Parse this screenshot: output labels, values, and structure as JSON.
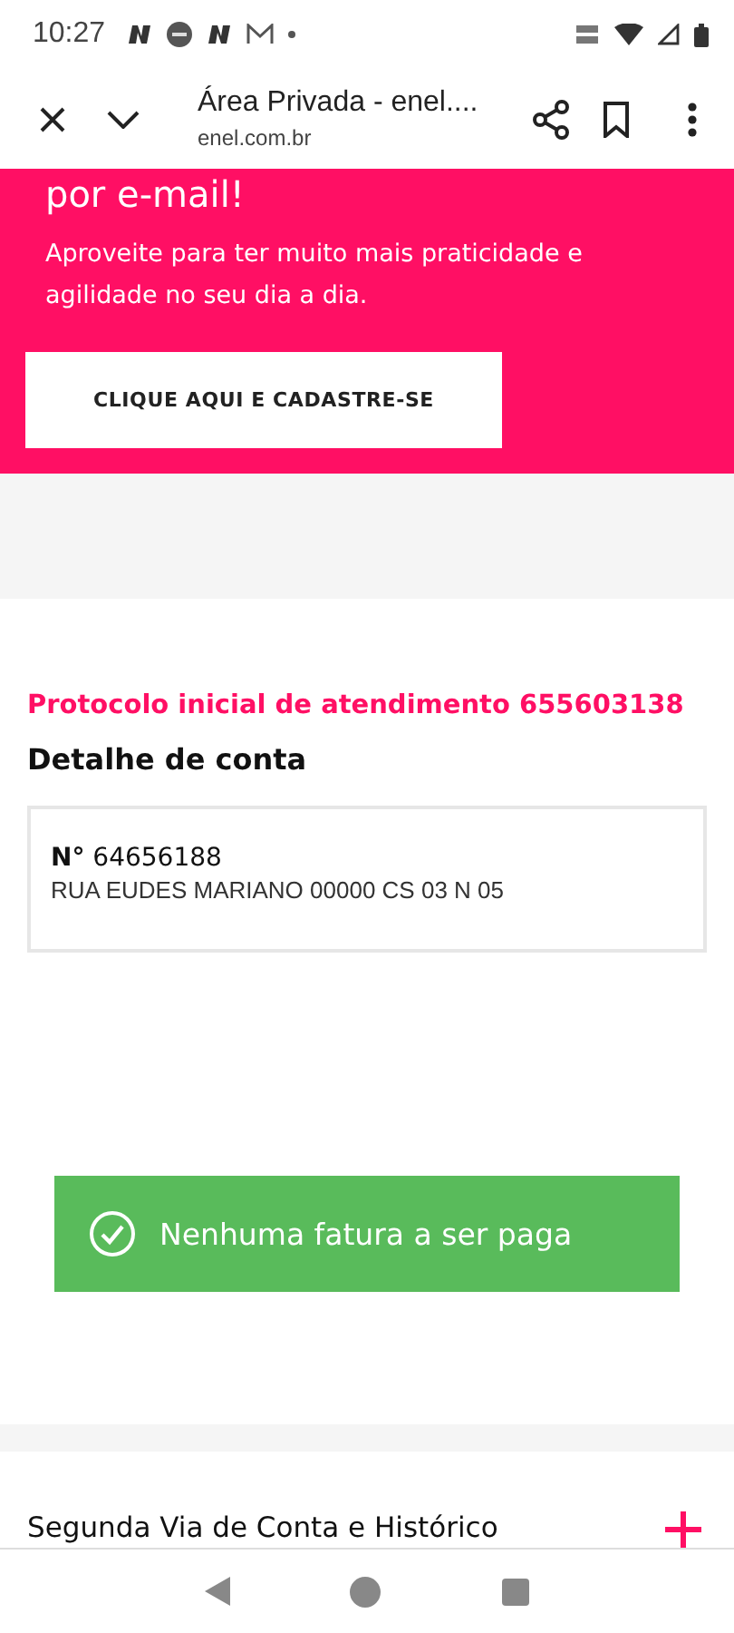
{
  "status_bar": {
    "time": "10:27"
  },
  "browser_bar": {
    "title": "Área Privada - enel....",
    "url": "enel.com.br"
  },
  "banner": {
    "heading": "por e-mail!",
    "text": "Aproveite para ter muito mais praticidade e agilidade no seu dia a dia.",
    "button": "CLIQUE AQUI E CADASTRE-SE"
  },
  "protocol": "Protocolo inicial de atendimento 655603138",
  "account": {
    "heading": "Detalhe de conta",
    "number_label": "N°",
    "number": "64656188",
    "address": "RUA EUDES MARIANO 00000 CS 03 N 05"
  },
  "notice": {
    "text": "Nenhuma fatura a ser paga"
  },
  "accordion": {
    "title": "Segunda Via de Conta e Histórico",
    "expanded": false
  }
}
